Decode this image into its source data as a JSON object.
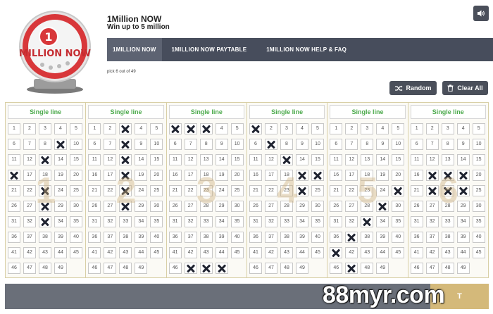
{
  "app": {
    "title": "1Million NOW",
    "subtitle": "Win up to 5 million",
    "logo_text": "MILLION NOW"
  },
  "tabs": [
    {
      "label": "1MILLION NOW"
    },
    {
      "label": "1MILLION NOW PAYTABLE"
    },
    {
      "label": "1MILLION NOW HELP & FAQ"
    }
  ],
  "pick_info": "pick 6 out of 49",
  "buttons": {
    "random_label": "Random",
    "clear_label": "Clear All",
    "bottom_label": "T"
  },
  "icons": {
    "sound": "speaker-icon",
    "random": "shuffle-icon",
    "clear": "trash-icon"
  },
  "colors": {
    "header_bar": "#474d5c",
    "active_tab": "#5d6372",
    "board_head_text": "#4caa4c",
    "board_border": "#d8cfa6",
    "bottom_gold": "#d4b97a"
  },
  "boards": [
    {
      "label": "Single line",
      "number": "1",
      "selected": [
        9,
        13,
        16,
        23,
        28,
        33
      ]
    },
    {
      "label": "Single line",
      "number": "2",
      "selected": [
        3,
        8,
        13,
        18,
        23,
        28
      ]
    },
    {
      "label": "Single line",
      "number": "3",
      "selected": [
        1,
        2,
        3,
        47,
        48,
        49
      ]
    },
    {
      "label": "Single line",
      "number": "4",
      "selected": [
        1,
        7,
        13,
        19,
        20,
        24
      ]
    },
    {
      "label": "Single line",
      "number": "5",
      "selected": [
        25,
        29,
        33,
        37,
        41,
        47
      ]
    },
    {
      "label": "Single line",
      "number": "6",
      "selected": [
        17,
        18,
        19,
        22,
        23,
        24
      ]
    }
  ],
  "watermark": "88myr.com"
}
